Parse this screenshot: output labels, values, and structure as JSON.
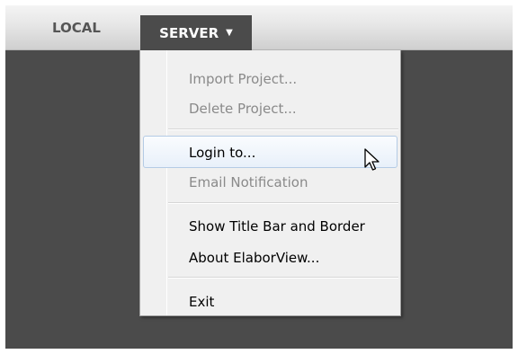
{
  "tabs": {
    "local_label": "LOCAL",
    "server_label": "SERVER",
    "server_caret": "▼"
  },
  "menu": {
    "items": [
      {
        "label": "Import Project...",
        "enabled": false
      },
      {
        "label": "Delete Project...",
        "enabled": false
      },
      {
        "label": "Login to...",
        "enabled": true,
        "hovered": true
      },
      {
        "label": "Email Notification",
        "enabled": false
      },
      {
        "label": "Show Title Bar and Border",
        "enabled": true
      },
      {
        "label": "About ElaborView...",
        "enabled": true
      },
      {
        "label": "Exit",
        "enabled": true
      }
    ]
  },
  "colors": {
    "background": "#4b4b4b",
    "menu_background": "#f0f0f0",
    "hover_border": "#b4cbe5",
    "disabled_text": "#8a8a8a"
  },
  "icons": {
    "pointer": "arrow-cursor-icon",
    "dropdown": "caret-down-icon"
  }
}
